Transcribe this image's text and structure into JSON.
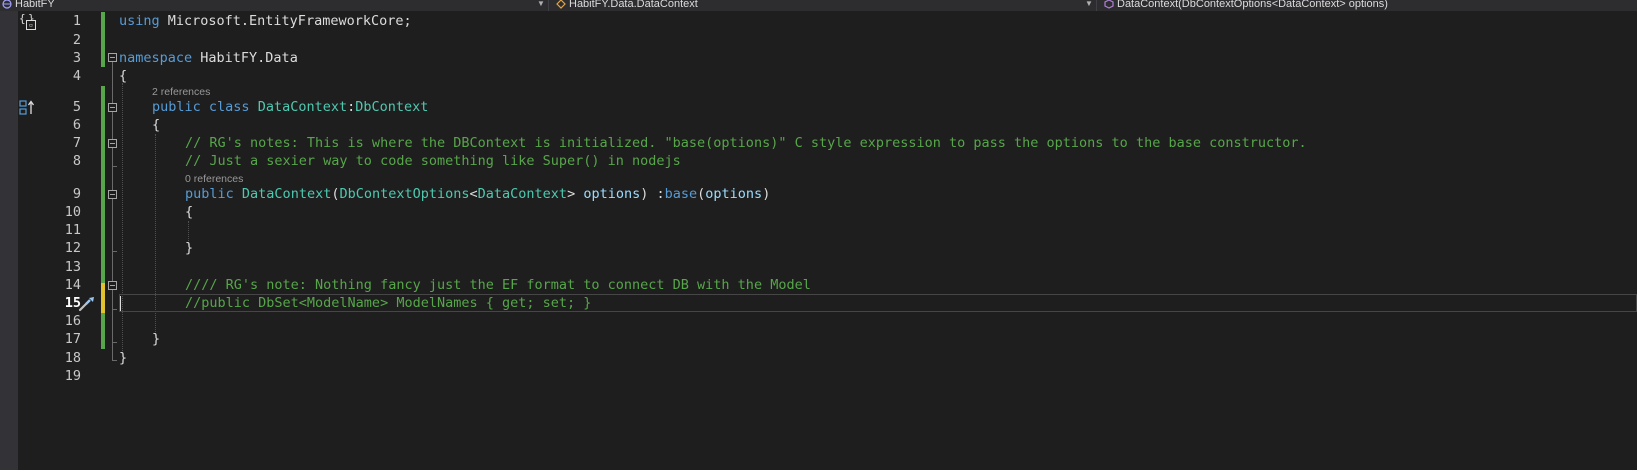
{
  "navbar": {
    "project": "HabitFY",
    "class": "HabitFY.Data.DataContext",
    "member": "DataContext(DbContextOptions<DataContext> options)"
  },
  "lenses": {
    "class_refs": "2 references",
    "ctor_refs": "0 references"
  },
  "line_numbers": [
    "1",
    "2",
    "3",
    "4",
    "5",
    "6",
    "7",
    "8",
    "9",
    "10",
    "11",
    "12",
    "13",
    "14",
    "15",
    "16",
    "17",
    "18",
    "19"
  ],
  "current_line": "15",
  "code": {
    "l1": {
      "kw": "using",
      "rest": " Microsoft.EntityFrameworkCore;"
    },
    "l3": {
      "kw": "namespace",
      "rest": " HabitFY.Data"
    },
    "l4": "{",
    "l5": {
      "kw1": "public",
      "kw2": "class",
      "name": "DataContext",
      "colon": ":",
      "base": "DbContext"
    },
    "l6": "{",
    "l7": "// RG's notes: This is where the DBContext is initialized. \"base(options)\" C style expression to pass the options to the base constructor.",
    "l8": "// Just a sexier way to code something like Super() in nodejs",
    "l9": {
      "kw": "public",
      "name": "DataContext",
      "p1": "(",
      "type": "DbContextOptions",
      "lt": "<",
      "generic": "DataContext",
      "gt": ">",
      "param": " options",
      "p2": ") :",
      "base": "base",
      "p3": "(",
      "arg": "options",
      "p4": ")"
    },
    "l10": "{",
    "l12": "}",
    "l14": "//// RG's note: Nothing fancy just the EF format to connect DB with the Model",
    "l15": "//public DbSet<ModelName> ModelNames { get; set; }",
    "l17": "}",
    "l18": "}"
  },
  "colors": {
    "background": "#1e1e1e",
    "keyword": "#569cd6",
    "type": "#4ec9b0",
    "comment": "#57a64a",
    "parameter": "#9cdcfe",
    "change_saved": "#57a64a",
    "change_unsaved": "#e0c32f"
  },
  "icons": [
    "project-icon",
    "class-icon",
    "method-icon",
    "namespace-scope-icon",
    "class-inheritance-icon",
    "quick-action-screwdriver-icon"
  ]
}
